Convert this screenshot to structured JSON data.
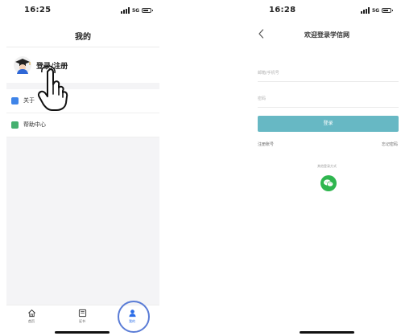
{
  "left_screen": {
    "status": {
      "time": "16:25",
      "network": "5G"
    },
    "header": {
      "title": "我的"
    },
    "profile": {
      "login_register": "登录/注册"
    },
    "menu": [
      {
        "label": "关于"
      },
      {
        "label": "帮助中心"
      }
    ],
    "tabs": [
      {
        "label": "首页"
      },
      {
        "label": "证书"
      },
      {
        "label": "我的"
      }
    ],
    "icons": {
      "avatar": "graduate-avatar-icon",
      "about": "info-icon",
      "help": "help-icon",
      "pointer": "hand-pointer-icon",
      "home": "home-icon",
      "certificate": "certificate-icon",
      "mine": "user-icon"
    },
    "colors": {
      "about_icon": "#3f84e8",
      "help_icon": "#45b06f",
      "active_tab": "#2b6de8",
      "highlight": "#5a7cd6"
    }
  },
  "right_screen": {
    "status": {
      "time": "16:28",
      "network": "5G"
    },
    "header": {
      "title": "欢迎登录学信网"
    },
    "form": {
      "account_placeholder": "邮箱/手机号",
      "password_placeholder": "密码",
      "login_button": "登录",
      "register_link": "注册账号",
      "forgot_link": "忘记密码",
      "third_party_label": "其他登录方式"
    },
    "icons": {
      "back": "chevron-left-icon",
      "wechat": "wechat-icon"
    },
    "colors": {
      "login_button": "#67b8c4",
      "wechat": "#2fb64f"
    }
  }
}
